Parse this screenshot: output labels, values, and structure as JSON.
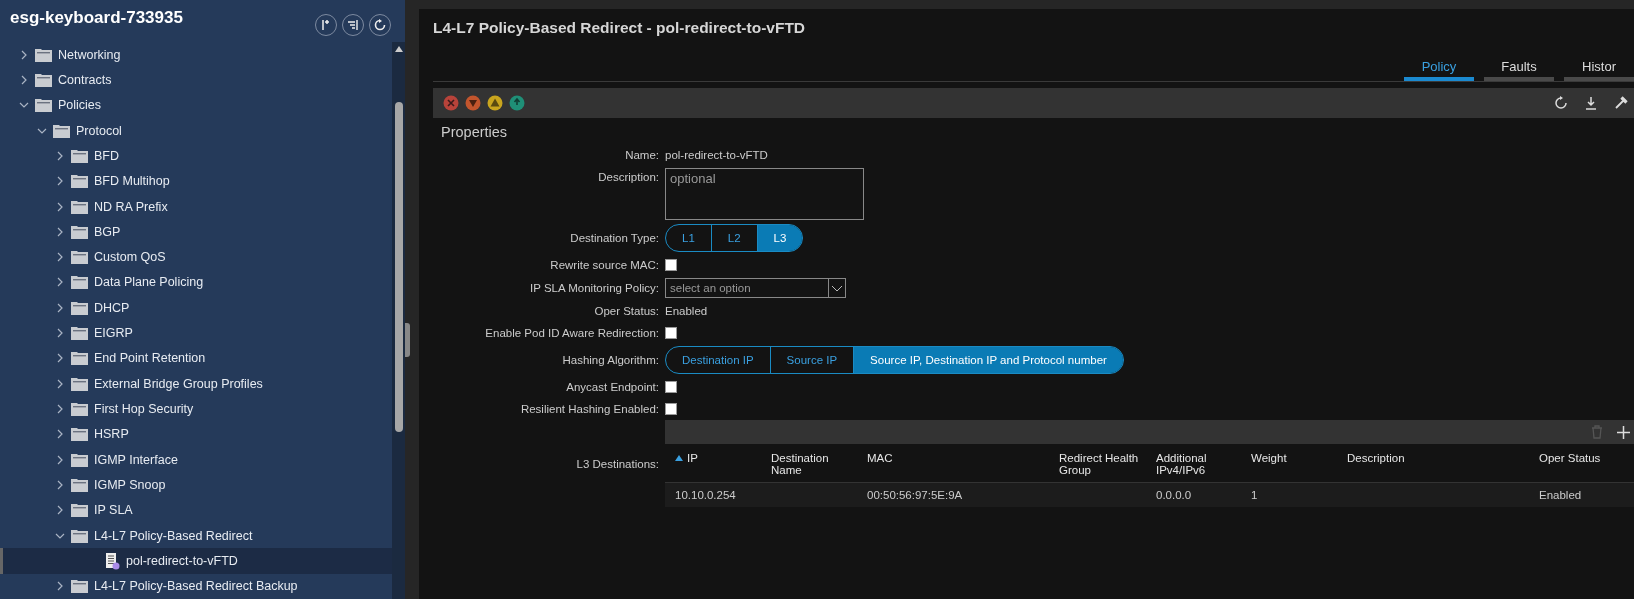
{
  "sidebar": {
    "title": "esg-keyboard-733935",
    "tree": [
      {
        "label": "Networking",
        "kind": "folder",
        "expanded": false,
        "selected": false
      },
      {
        "label": "Contracts",
        "kind": "folder",
        "expanded": false,
        "selected": false
      },
      {
        "label": "Policies",
        "kind": "folder",
        "expanded": true,
        "selected": false,
        "children": [
          {
            "label": "Protocol",
            "kind": "folder",
            "expanded": true,
            "selected": false,
            "children": [
              {
                "label": "BFD",
                "kind": "folder",
                "expanded": false,
                "selected": false
              },
              {
                "label": "BFD Multihop",
                "kind": "folder",
                "expanded": false,
                "selected": false
              },
              {
                "label": "ND RA Prefix",
                "kind": "folder",
                "expanded": false,
                "selected": false
              },
              {
                "label": "BGP",
                "kind": "folder",
                "expanded": false,
                "selected": false
              },
              {
                "label": "Custom QoS",
                "kind": "folder",
                "expanded": false,
                "selected": false
              },
              {
                "label": "Data Plane Policing",
                "kind": "folder",
                "expanded": false,
                "selected": false
              },
              {
                "label": "DHCP",
                "kind": "folder",
                "expanded": false,
                "selected": false
              },
              {
                "label": "EIGRP",
                "kind": "folder",
                "expanded": false,
                "selected": false
              },
              {
                "label": "End Point Retention",
                "kind": "folder",
                "expanded": false,
                "selected": false
              },
              {
                "label": "External Bridge Group Profiles",
                "kind": "folder",
                "expanded": false,
                "selected": false
              },
              {
                "label": "First Hop Security",
                "kind": "folder",
                "expanded": false,
                "selected": false
              },
              {
                "label": "HSRP",
                "kind": "folder",
                "expanded": false,
                "selected": false
              },
              {
                "label": "IGMP Interface",
                "kind": "folder",
                "expanded": false,
                "selected": false
              },
              {
                "label": "IGMP Snoop",
                "kind": "folder",
                "expanded": false,
                "selected": false
              },
              {
                "label": "IP SLA",
                "kind": "folder",
                "expanded": false,
                "selected": false
              },
              {
                "label": "L4-L7 Policy-Based Redirect",
                "kind": "folder",
                "expanded": true,
                "selected": false,
                "children": [
                  {
                    "label": "pol-redirect-to-vFTD",
                    "kind": "leaf",
                    "selected": true
                  }
                ]
              },
              {
                "label": "L4-L7 Policy-Based Redirect Backup",
                "kind": "folder",
                "expanded": false,
                "selected": false
              }
            ]
          }
        ]
      }
    ]
  },
  "panel": {
    "title": "L4-L7 Policy-Based Redirect - pol-redirect-to-vFTD",
    "tabs": [
      {
        "label": "Policy",
        "selected": true
      },
      {
        "label": "Faults",
        "selected": false
      },
      {
        "label": "Histor",
        "selected": false
      }
    ],
    "section": "Properties",
    "fields": [
      {
        "kind": "text",
        "label": "Name:",
        "value": "pol-redirect-to-vFTD"
      },
      {
        "kind": "textarea",
        "label": "Description:",
        "placeholder": "optional"
      },
      {
        "kind": "segmented",
        "label": "Destination Type:",
        "options": [
          {
            "label": "L1",
            "selected": false
          },
          {
            "label": "L2",
            "selected": false
          },
          {
            "label": "L3",
            "selected": true
          }
        ]
      },
      {
        "kind": "checkbox",
        "label": "Rewrite source MAC:",
        "checked": false
      },
      {
        "kind": "select",
        "label": "IP SLA Monitoring Policy:",
        "placeholder": "select an option"
      },
      {
        "kind": "text",
        "label": "Oper Status:",
        "value": "Enabled"
      },
      {
        "kind": "checkbox",
        "label": "Enable Pod ID Aware Redirection:",
        "checked": false
      },
      {
        "kind": "segmented",
        "label": "Hashing Algorithm:",
        "options": [
          {
            "label": "Destination IP",
            "selected": false
          },
          {
            "label": "Source IP",
            "selected": false
          },
          {
            "label": "Source IP, Destination IP and Protocol number",
            "selected": true
          }
        ]
      },
      {
        "kind": "checkbox",
        "label": "Anycast Endpoint:",
        "checked": false
      },
      {
        "kind": "checkbox",
        "label": "Resilient Hashing Enabled:",
        "checked": false
      },
      {
        "kind": "table",
        "label": "L3 Destinations:"
      }
    ],
    "table": {
      "columns": [
        "IP",
        "Destination Name",
        "MAC",
        "Redirect Health Group",
        "Additional IPv4/IPv6",
        "Weight",
        "Description",
        "Oper Status"
      ],
      "rows": [
        [
          "10.10.0.254",
          "",
          "00:50:56:97:5E:9A",
          "",
          "0.0.0.0",
          "1",
          "",
          "Enabled"
        ]
      ]
    }
  }
}
